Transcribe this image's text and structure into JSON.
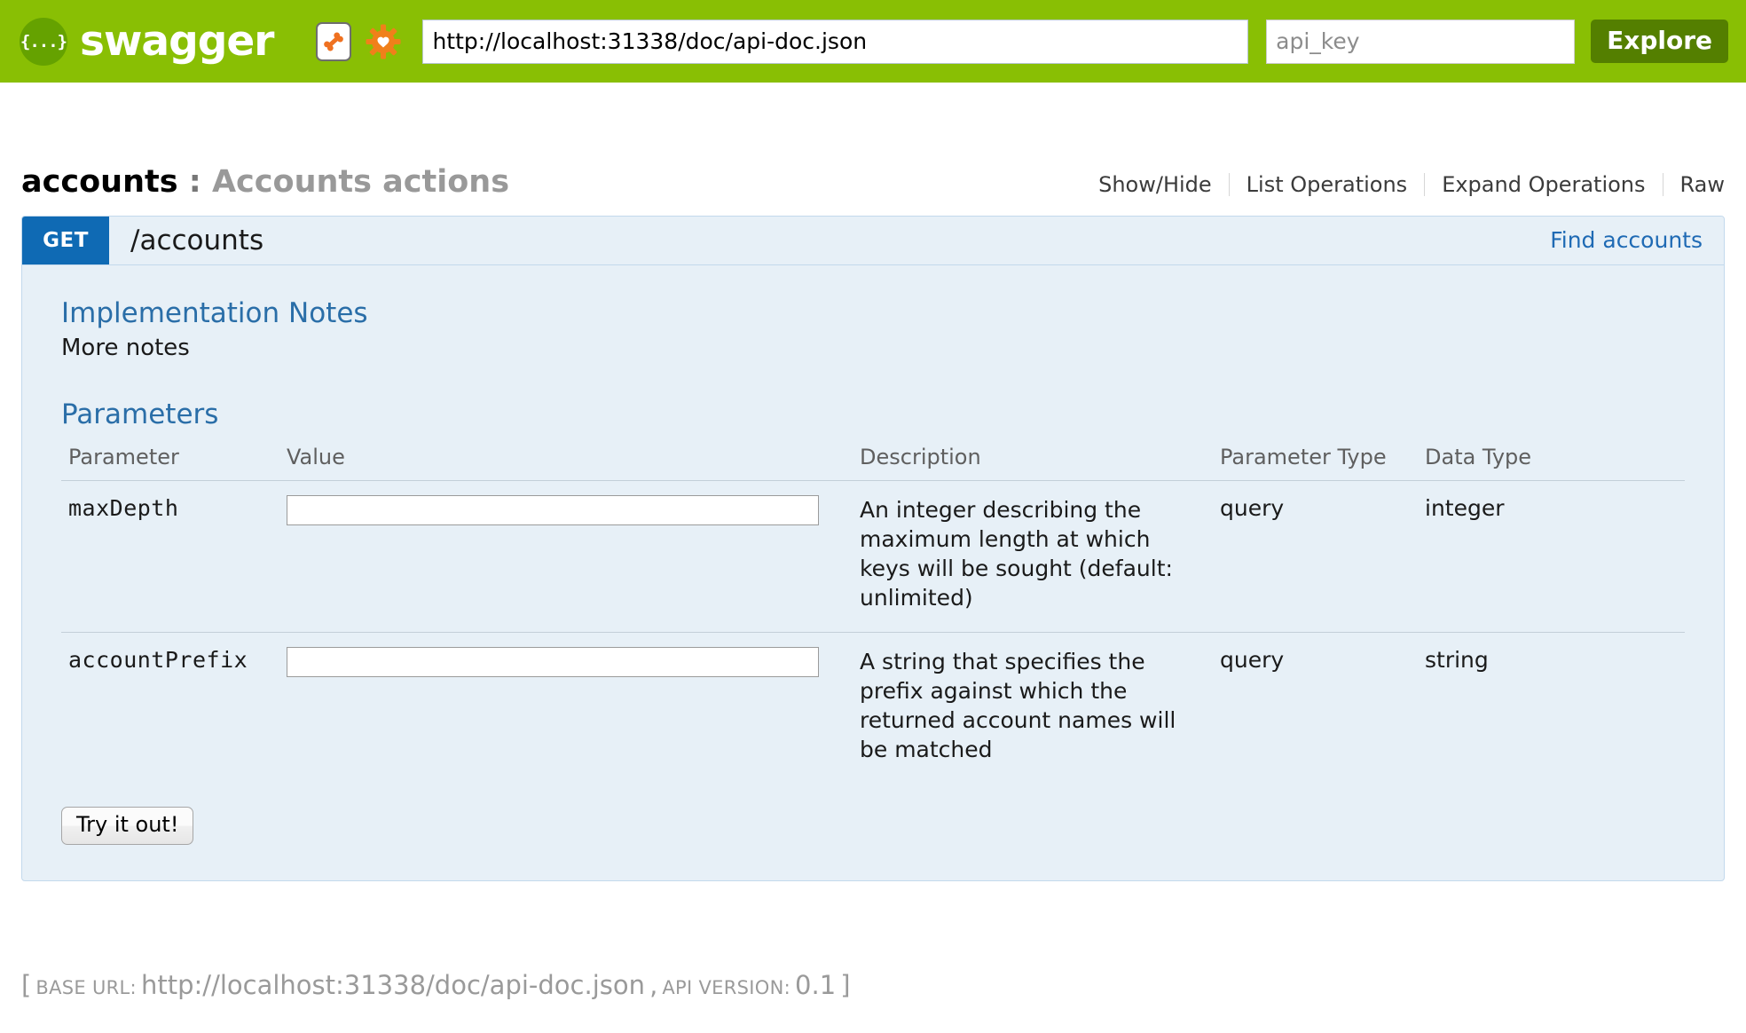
{
  "topbar": {
    "logo_text": "swagger",
    "logo_mark": "{...}",
    "bone_icon_name": "bone-icon",
    "gear_icon_name": "gear-icon",
    "url_value": "http://localhost:31338/doc/api-doc.json",
    "url_placeholder": "http://example.com/api-docs",
    "api_key_value": "",
    "api_key_placeholder": "api_key",
    "explore_label": "Explore",
    "bar_color": "#89bf04",
    "explore_color": "#547f00",
    "logo_circle_color": "#65a200"
  },
  "resource": {
    "name": "accounts",
    "separator": " : ",
    "description": "Accounts actions",
    "options": [
      {
        "label": "Show/Hide"
      },
      {
        "label": "List Operations"
      },
      {
        "label": "Expand Operations"
      },
      {
        "label": "Raw"
      }
    ]
  },
  "operation": {
    "method": "GET",
    "method_color": "#0f6ab4",
    "path": "/accounts",
    "summary": "Find accounts",
    "notes_title": "Implementation Notes",
    "notes_text": "More notes",
    "parameters_title": "Parameters",
    "table": {
      "headers": [
        "Parameter",
        "Value",
        "Description",
        "Parameter Type",
        "Data Type"
      ],
      "rows": [
        {
          "name": "maxDepth",
          "value": "",
          "description": "An integer describing the maximum length at which keys will be sought (default: unlimited)",
          "param_type": "query",
          "data_type": "integer"
        },
        {
          "name": "accountPrefix",
          "value": "",
          "description": "A string that specifies the prefix against which the returned account names will be matched",
          "param_type": "query",
          "data_type": "string"
        }
      ]
    },
    "try_it_out_label": "Try it out!"
  },
  "footer": {
    "open_bracket": "[",
    "base_url_label": "Base URL:",
    "base_url_value": "http://localhost:31338/doc/api-doc.json",
    "comma": ",",
    "api_version_label": "api version:",
    "api_version_value": "0.1",
    "close_bracket": "]"
  }
}
